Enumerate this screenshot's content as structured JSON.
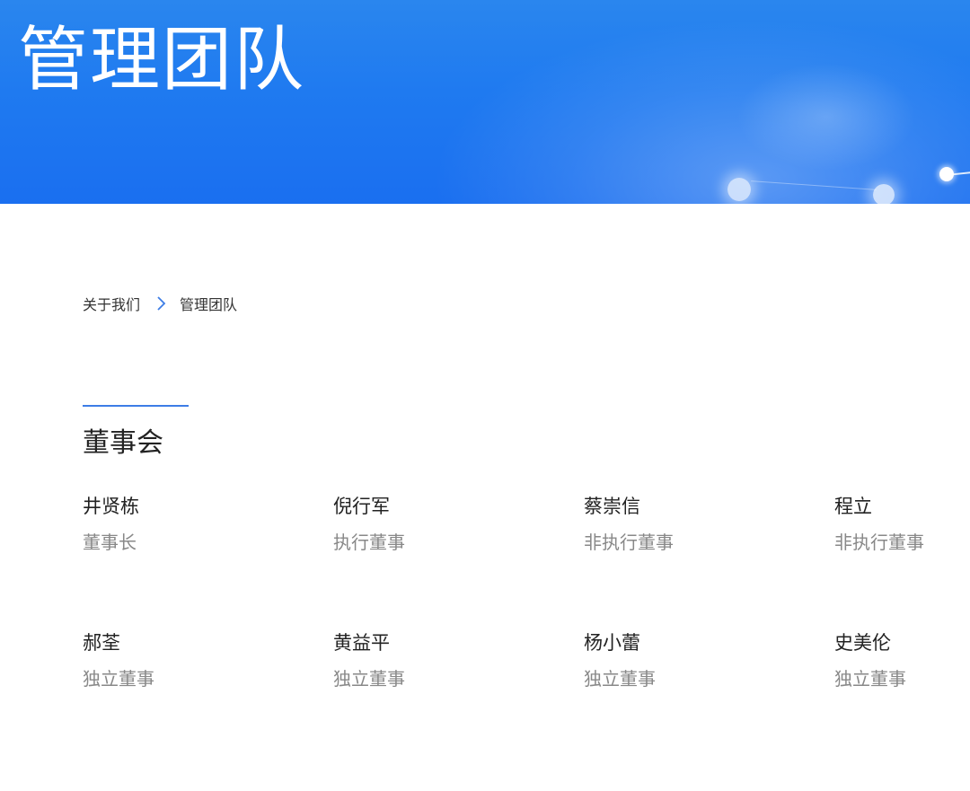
{
  "banner": {
    "title": "管理团队"
  },
  "breadcrumb": {
    "parent": "关于我们",
    "current": "管理团队"
  },
  "section": {
    "title": "董事会"
  },
  "members": [
    {
      "name": "井贤栋",
      "role": "董事长"
    },
    {
      "name": "倪行军",
      "role": "执行董事"
    },
    {
      "name": "蔡崇信",
      "role": "非执行董事"
    },
    {
      "name": "程立",
      "role": "非执行董事"
    },
    {
      "name": "郝荃",
      "role": "独立董事"
    },
    {
      "name": "黄益平",
      "role": "独立董事"
    },
    {
      "name": "杨小蕾",
      "role": "独立董事"
    },
    {
      "name": "史美伦",
      "role": "独立董事"
    }
  ],
  "colors": {
    "banner": "#1f7af0",
    "accent": "#3d7de6",
    "name_text": "#222222",
    "role_text": "#888888"
  }
}
